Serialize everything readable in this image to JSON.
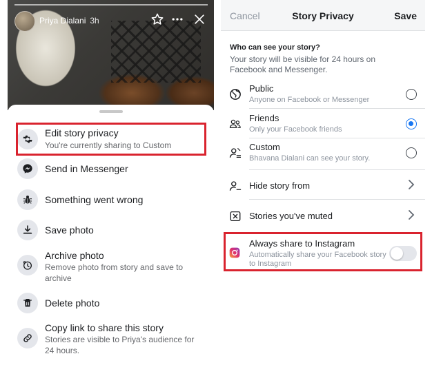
{
  "story_view": {
    "user_name": "Priya Dialani",
    "time": "3h",
    "icons": [
      "star-icon",
      "more-icon",
      "close-icon"
    ]
  },
  "menu": {
    "items": [
      {
        "title": "Edit story privacy",
        "subtitle": "You're currently sharing to Custom",
        "icon": "gear-icon"
      },
      {
        "title": "Send in Messenger",
        "subtitle": "",
        "icon": "messenger-icon"
      },
      {
        "title": "Something went wrong",
        "subtitle": "",
        "icon": "bug-icon"
      },
      {
        "title": "Save photo",
        "subtitle": "",
        "icon": "download-icon"
      },
      {
        "title": "Archive photo",
        "subtitle": "Remove photo from story and save to archive",
        "icon": "archive-clock-icon"
      },
      {
        "title": "Delete photo",
        "subtitle": "",
        "icon": "trash-icon"
      },
      {
        "title": "Copy link to share this story",
        "subtitle": "Stories are visible to Priya's audience for 24 hours.",
        "icon": "link-icon"
      }
    ]
  },
  "privacy": {
    "cancel_label": "Cancel",
    "title": "Story Privacy",
    "save_label": "Save",
    "question": "Who can see your story?",
    "description": "Your story will be visible for 24 hours on Facebook and Messenger.",
    "options": [
      {
        "title": "Public",
        "subtitle": "Anyone on Facebook or Messenger",
        "selected": false,
        "icon": "globe-icon"
      },
      {
        "title": "Friends",
        "subtitle": "Only your Facebook friends",
        "selected": true,
        "icon": "friends-icon"
      },
      {
        "title": "Custom",
        "subtitle": "Bhavana Dialani can see your story.",
        "selected": false,
        "icon": "custom-person-icon"
      }
    ],
    "links": [
      {
        "title": "Hide story from",
        "icon": "hide-person-icon"
      },
      {
        "title": "Stories you've muted",
        "icon": "muted-box-icon"
      }
    ],
    "instagram": {
      "title": "Always share to Instagram",
      "subtitle": "Automatically share your Facebook story to Instagram",
      "enabled": false,
      "icon": "instagram-icon"
    }
  },
  "colors": {
    "highlight": "#d9232e",
    "accent": "#1877f2"
  }
}
